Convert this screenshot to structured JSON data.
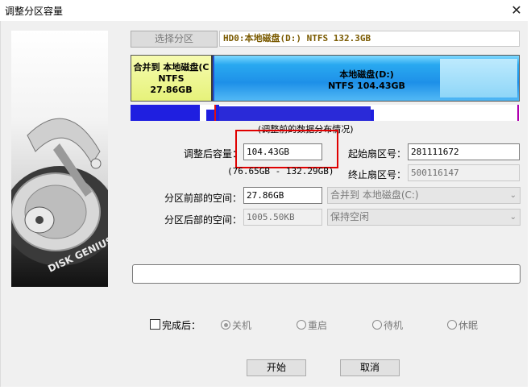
{
  "window": {
    "title": "调整分区容量",
    "close_symbol": "✕"
  },
  "select_partition_button": "选择分区",
  "disk_info": "HD0:本地磁盘(D:) NTFS 132.3GB",
  "partitions": [
    {
      "line1": "合并到 本地磁盘(C",
      "line2": "NTFS",
      "line3": "27.86GB"
    },
    {
      "line1": "本地磁盘(D:)",
      "line2": "NTFS 104.43GB"
    }
  ],
  "distribution_caption": "(调整前的数据分布情况)",
  "form": {
    "size_label": "调整后容量：",
    "size_value": "104.43GB",
    "size_range": "(76.65GB - 132.29GB)",
    "start_sector_label": "起始扇区号：",
    "start_sector_value": "281111672",
    "end_sector_label": "终止扇区号：",
    "end_sector_value": "500116147",
    "front_space_label": "分区前部的空间：",
    "front_space_value": "27.86GB",
    "front_action": "合并到 本地磁盘(C:)",
    "back_space_label": "分区后部的空间：",
    "back_space_value": "1005.50KB",
    "back_action": "保持空闲"
  },
  "after_complete": {
    "label": "完成后：",
    "options": [
      "关机",
      "重启",
      "待机",
      "休眠"
    ],
    "selected": "关机"
  },
  "buttons": {
    "start": "开始",
    "cancel": "取消"
  },
  "logo_text": "DISK GENIUS",
  "colors": {
    "partition1": "#e6f27a",
    "partition2": "#1e90e8",
    "highlight": "#e00000",
    "disk_info_text": "#7a5a00"
  }
}
